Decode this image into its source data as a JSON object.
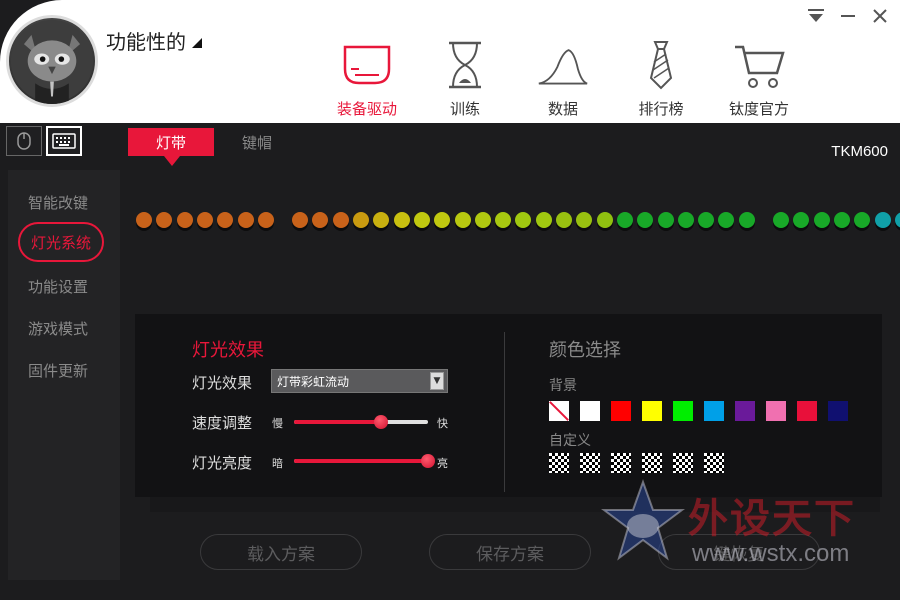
{
  "header": {
    "profile_name": "功能性的",
    "nav": [
      {
        "label": "装备驱动",
        "icon": "device-driver-icon",
        "active": true
      },
      {
        "label": "训练",
        "icon": "hourglass-icon",
        "active": false
      },
      {
        "label": "数据",
        "icon": "bell-curve-icon",
        "active": false
      },
      {
        "label": "排行榜",
        "icon": "tie-icon",
        "active": false
      },
      {
        "label": "钛度官方",
        "icon": "shopping-cart-icon",
        "active": false
      }
    ]
  },
  "device_tabs": [
    {
      "icon": "mouse-icon",
      "active": false
    },
    {
      "icon": "keyboard-icon",
      "active": true
    }
  ],
  "sidebar": {
    "items": [
      {
        "label": "智能改键",
        "active": false
      },
      {
        "label": "灯光系统",
        "active": true
      },
      {
        "label": "功能设置",
        "active": false
      },
      {
        "label": "游戏模式",
        "active": false
      },
      {
        "label": "固件更新",
        "active": false
      }
    ]
  },
  "tabs": [
    {
      "label": "灯带",
      "active": true
    },
    {
      "label": "键帽",
      "active": false
    }
  ],
  "model": "TKM600",
  "led_colors": [
    "#c8621a",
    "#c8621a",
    "#c8621a",
    "#c8621a",
    "#c8621a",
    "#c8621a",
    "#c8621a",
    "#c8621a",
    "#c8621a",
    "#c8621a",
    "#c89a10",
    "#c8b010",
    "#c8c010",
    "#c0c810",
    "#c0c810",
    "#b8c810",
    "#b0c810",
    "#a8c810",
    "#a0c810",
    "#a0c810",
    "#98c010",
    "#98c010",
    "#90c010",
    "#18a828",
    "#18a828",
    "#18a828",
    "#18a828",
    "#18a828",
    "#18a828",
    "#18a828",
    "#18a828",
    "#18a828",
    "#18a828",
    "#18a828",
    "#18a828",
    "#10a0a8",
    "#10a0a8"
  ],
  "light_panel": {
    "title": "灯光效果",
    "effect_label": "灯光效果",
    "effect_value": "灯带彩虹流动",
    "speed_label": "速度调整",
    "speed_min": "慢",
    "speed_max": "快",
    "speed_value": 0.65,
    "brightness_label": "灯光亮度",
    "brightness_min": "暗",
    "brightness_max": "亮",
    "brightness_value": 1.0
  },
  "color_panel": {
    "title": "颜色选择",
    "background_label": "背景",
    "background_colors": [
      "none",
      "#ffffff",
      "#ff0000",
      "#ffff00",
      "#00ee00",
      "#00a0e8",
      "#6a1a9a",
      "#f070b0",
      "#e8103a",
      "#101070"
    ],
    "custom_label": "自定义",
    "custom_count": 6
  },
  "buttons": {
    "load": "载入方案",
    "save": "保存方案",
    "restore": "键恢复"
  },
  "watermark": {
    "title": "外设天下",
    "url": "www.wstx.com"
  },
  "accent": "#e8173a"
}
